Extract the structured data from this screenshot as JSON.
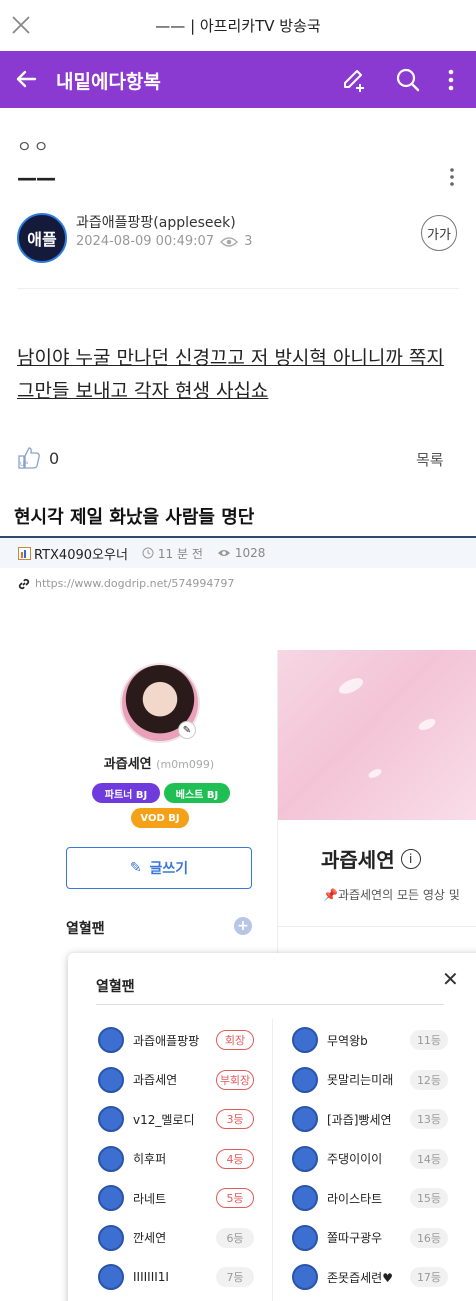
{
  "window": {
    "title": "—— | 아프리카TV 방송국"
  },
  "header": {
    "channel_name": "내밑에다항복"
  },
  "post": {
    "dots": "ㅇㅇ",
    "subject": "——",
    "author": "과즙애플팡팡(appleseek)",
    "avatar_text": "애플",
    "date": "2024-08-09 00:49:07",
    "views": "3",
    "font_button": "가가",
    "body": "남이야 누굴 만나던 신경끄고 저 방시혁 아니니까 쪽지 그만들 보내고 각자 현생 사십쇼",
    "likes": "0",
    "list_label": "목록"
  },
  "ref": {
    "title": "현시각 제일 화났을 사람들 명단",
    "nick": "RTX4090오우너",
    "time": "11 분 전",
    "views": "1028",
    "url": "https://www.dogdrip.net/574994797"
  },
  "embed": {
    "profile_name": "과즙세연",
    "profile_id": "(m0m099)",
    "tags": [
      "파트너 BJ",
      "베스트 BJ",
      "VOD BJ"
    ],
    "write_label": "글쓰기",
    "fan_label": "열혈팬",
    "channel_title": "과즙세연",
    "channel_desc": "📌과즙세연의 모든 영상 및",
    "modal_title": "열혈팬",
    "left_ranks": [
      {
        "name": "과즙애플팡팡",
        "rank": "회장"
      },
      {
        "name": "과즙세연",
        "rank": "부회장"
      },
      {
        "name": "v12_멜로디",
        "rank": "3등"
      },
      {
        "name": "히후퍼",
        "rank": "4등"
      },
      {
        "name": "라네트",
        "rank": "5등"
      },
      {
        "name": "깐세연",
        "rank": "6등"
      },
      {
        "name": "IIIIIII1I",
        "rank": "7등"
      }
    ],
    "right_ranks": [
      {
        "name": "무역왕b",
        "rank": "11등"
      },
      {
        "name": "못말리는미래",
        "rank": "12등"
      },
      {
        "name": "[과즙]빵세연",
        "rank": "13등"
      },
      {
        "name": "주댕이이이",
        "rank": "14등"
      },
      {
        "name": "라이스타트",
        "rank": "15등"
      },
      {
        "name": "쫄따구광우",
        "rank": "16등"
      },
      {
        "name": "존못즙세련♥",
        "rank": "17등"
      }
    ]
  },
  "colors": {
    "brand_purple": "#8a3ad1",
    "accent_blue": "#3a78d8",
    "rank_red": "#e35b5b"
  }
}
